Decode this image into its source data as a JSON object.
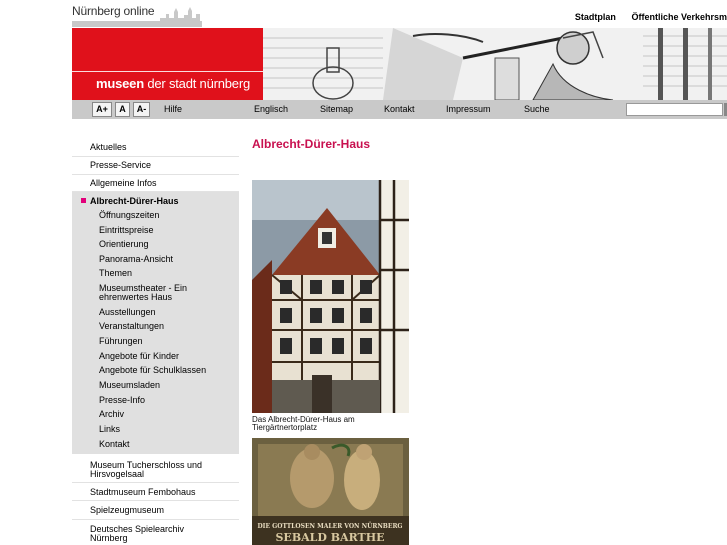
{
  "header": {
    "brand": "Nürnberg online",
    "links": [
      "Stadtplan",
      "Öffentliche Verkehrsm"
    ]
  },
  "banner": {
    "title_bold": "museen",
    "title_rest": " der stadt nürnberg"
  },
  "navbar": {
    "font_buttons": [
      "A+",
      "A",
      "A-"
    ],
    "help": "Hilfe",
    "links": [
      "Englisch",
      "Sitemap",
      "Kontakt",
      "Impressum",
      "Suche"
    ],
    "search_value": ""
  },
  "sidebar": {
    "top_items": [
      "Aktuelles",
      "Presse-Service",
      "Allgemeine Infos"
    ],
    "active_item": "Albrecht-Dürer-Haus",
    "sub_items": [
      "Öffnungszeiten",
      "Eintrittspreise",
      "Orientierung",
      "Panorama-Ansicht",
      "Themen",
      "Museumstheater - Ein",
      "ehrenwertes Haus",
      "Ausstellungen",
      "Veranstaltungen",
      "Führungen",
      "Angebote für Kinder",
      "Angebote für Schulklassen",
      "Museumsladen",
      "Presse-Info",
      "Archiv",
      "Links",
      "Kontakt"
    ],
    "bottom_items": [
      [
        "Museum Tucherschloss und",
        "Hirsvogelsaal"
      ],
      [
        "Stadtmuseum Fembohaus"
      ],
      [
        "Spielzeugmuseum"
      ],
      [
        "Deutsches Spielearchiv",
        "Nürnberg"
      ]
    ]
  },
  "main": {
    "title": "Albrecht-Dürer-Haus",
    "caption": [
      "Das Albrecht-Dürer-Haus am",
      "Tiergärtnertorplatz"
    ],
    "poster_line1": "DIE GOTTLOSEN MALER VON NÜRNBERG",
    "poster_line2": "SEBALD BARTHE"
  },
  "colors": {
    "accent_red": "#e0111b",
    "title_magenta": "#c8104f",
    "bullet": "#e2007a",
    "navbar_gray": "#c9c9c9"
  }
}
